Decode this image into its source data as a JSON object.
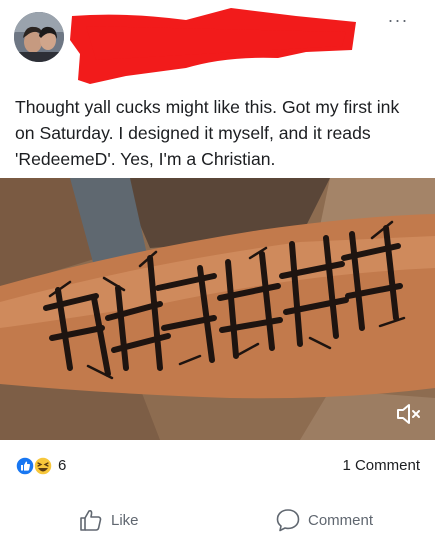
{
  "post": {
    "text": "Thought yall cucks might like this. Got my first ink on Saturday. I designed it myself, and it reads 'RedeemeD'. Yes, I'm a Christian.",
    "more_label": "···"
  },
  "reactions": {
    "count": "6",
    "comments": "1 Comment",
    "icons": [
      "like-icon",
      "haha-icon"
    ]
  },
  "actions": {
    "like_label": "Like",
    "comment_label": "Comment"
  },
  "colors": {
    "redaction": "#f21b1b",
    "like_blue": "#1877f2",
    "haha_yellow": "#f7c73b",
    "text_secondary": "#606770"
  }
}
